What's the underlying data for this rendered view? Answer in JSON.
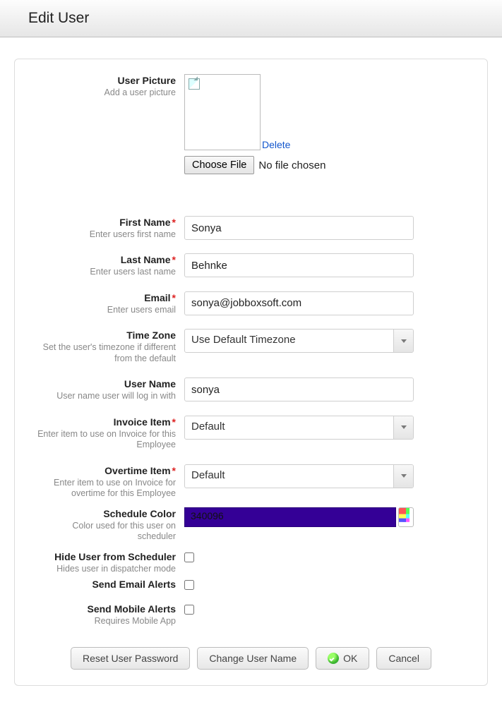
{
  "header": {
    "title": "Edit User"
  },
  "picture": {
    "label": "User Picture",
    "hint": "Add a user picture",
    "delete": "Delete",
    "choose": "Choose File",
    "nofile": "No file chosen"
  },
  "firstName": {
    "label": "First Name",
    "hint": "Enter users first name",
    "value": "Sonya"
  },
  "lastName": {
    "label": "Last Name",
    "hint": "Enter users last name",
    "value": "Behnke"
  },
  "email": {
    "label": "Email",
    "hint": "Enter users email",
    "value": "sonya@jobboxsoft.com"
  },
  "timezone": {
    "label": "Time Zone",
    "hint": "Set the user's timezone if different from the default",
    "value": "Use Default Timezone"
  },
  "username": {
    "label": "User Name",
    "hint": "User name user will log in with",
    "value": "sonya"
  },
  "invoiceItem": {
    "label": "Invoice Item",
    "hint": "Enter item to use on Invoice for this Employee",
    "value": "Default"
  },
  "overtimeItem": {
    "label": "Overtime Item",
    "hint": "Enter item to use on Invoice for overtime for this Employee",
    "value": "Default"
  },
  "scheduleColor": {
    "label": "Schedule Color",
    "hint": "Color used for this user on scheduler",
    "value": "340096",
    "hex": "#340096"
  },
  "hideUser": {
    "label": "Hide User from Scheduler",
    "hint": "Hides user in dispatcher mode",
    "checked": false
  },
  "sendEmail": {
    "label": "Send Email Alerts",
    "checked": false
  },
  "sendMobile": {
    "label": "Send Mobile Alerts",
    "hint": "Requires Mobile App",
    "checked": false
  },
  "buttons": {
    "reset": "Reset User Password",
    "changeUser": "Change User Name",
    "ok": "OK",
    "cancel": "Cancel"
  }
}
